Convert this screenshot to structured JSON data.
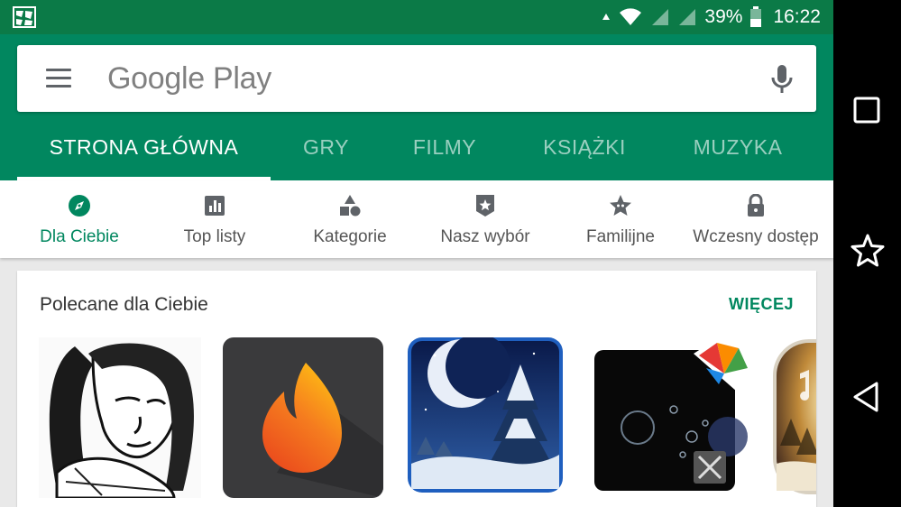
{
  "status_bar": {
    "battery": "39%",
    "time": "16:22",
    "icons": [
      "notification-icon",
      "data-arrow-icon",
      "wifi-icon",
      "signal-icon",
      "signal-icon",
      "battery-icon"
    ]
  },
  "search": {
    "brand": "Google Play"
  },
  "tabs": [
    {
      "label": "STRONA GŁÓWNA",
      "active": true
    },
    {
      "label": "GRY",
      "active": false
    },
    {
      "label": "FILMY",
      "active": false
    },
    {
      "label": "KSIĄŻKI",
      "active": false
    },
    {
      "label": "MUZYKA",
      "active": false
    }
  ],
  "subnav": [
    {
      "label": "Dla Ciebie",
      "icon": "compass-icon",
      "active": true
    },
    {
      "label": "Top listy",
      "icon": "bar-chart-icon",
      "active": false
    },
    {
      "label": "Kategorie",
      "icon": "shapes-icon",
      "active": false
    },
    {
      "label": "Nasz wybór",
      "icon": "star-badge-icon",
      "active": false
    },
    {
      "label": "Familijne",
      "icon": "family-star-icon",
      "active": false
    },
    {
      "label": "Wczesny dostęp",
      "icon": "lock-icon",
      "active": false
    }
  ],
  "section": {
    "title": "Polecane dla Ciebie",
    "more": "WIĘCEJ"
  },
  "apps": [
    {
      "icon": "sketch-portrait-app-icon"
    },
    {
      "icon": "flame-app-icon"
    },
    {
      "icon": "winter-moon-app-icon"
    },
    {
      "icon": "bubbles-wallpaper-app-icon"
    },
    {
      "icon": "winter-music-app-icon"
    }
  ],
  "colors": {
    "brand_green": "#01875f",
    "status_green": "#0b7a47"
  }
}
